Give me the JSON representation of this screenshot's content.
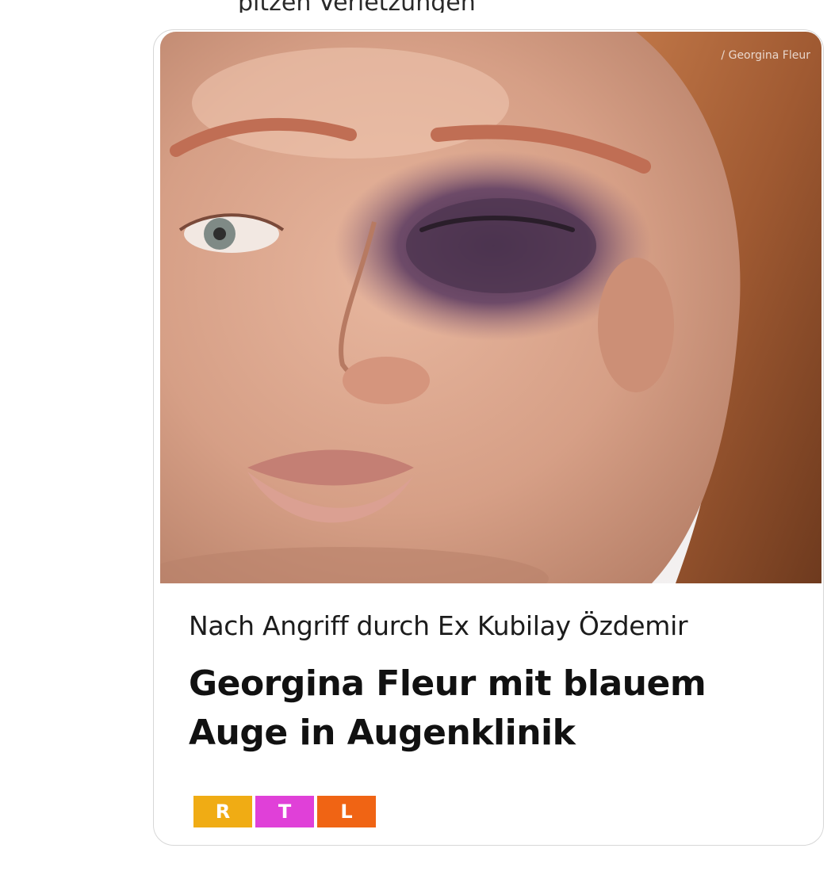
{
  "top_cut_text": "pitzen Verletzungen",
  "card": {
    "image": {
      "alt": "Foto einer Frau mit blauem Auge",
      "credit": "/ Georgina Fleur"
    },
    "kicker": "Nach Angriff durch Ex Kubilay Özdemir",
    "headline": "Georgina Fleur mit blauem Auge in Augenklinik",
    "logo": {
      "letters": [
        "R",
        "T",
        "L"
      ],
      "colors": [
        "#f0ac14",
        "#e040d8",
        "#f06414"
      ]
    }
  }
}
